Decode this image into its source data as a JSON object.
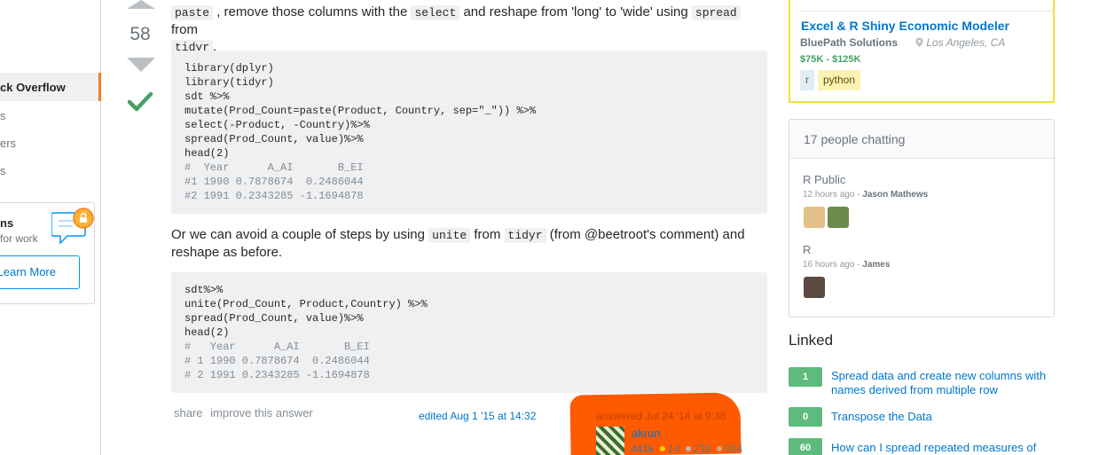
{
  "left_nav": {
    "stack_overflow": "ck Overflow",
    "item1": "s",
    "item2": "ers",
    "item3": "s",
    "teams_title": "ns",
    "teams_sub": "for work",
    "learn_more": "Learn More"
  },
  "vote": {
    "count": "58"
  },
  "answer": {
    "intro_pre": ", remove those columns with the",
    "intro_code1": "paste",
    "intro_code2": "select",
    "intro_mid": "and reshape from 'long' to 'wide' using",
    "intro_code3": "spread",
    "intro_from": "from",
    "intro_code4": "tidyr",
    "intro_end": ".",
    "code1": [
      "library(dplyr)",
      "library(tidyr)",
      "sdt %>%",
      "mutate(Prod_Count=paste(Product, Country, sep=\"_\")) %>%",
      "select(-Product, -Country)%>%",
      "spread(Prod_Count, value)%>%",
      "head(2)"
    ],
    "code1_comments": [
      "#  Year      A_AI       B_EI",
      "#1 1990 0.7878674  0.2486044",
      "#2 1991 0.2343285 -1.1694878"
    ],
    "para2_a": "Or we can avoid a couple of steps by using",
    "para2_code1": "unite",
    "para2_from": "from",
    "para2_code2": "tidyr",
    "para2_b": "(from @beetroot's comment) and",
    "para2_c": "reshape as before.",
    "code2": [
      "sdt%>%",
      "unite(Prod_Count, Product,Country) %>%",
      "spread(Prod_Count, value)%>%",
      "head(2)"
    ],
    "code2_comments": [
      "#   Year      A_AI       B_EI",
      "# 1 1990 0.7878674  0.2486044",
      "# 2 1991 0.2343285 -1.1694878"
    ],
    "share": "share",
    "improve": "improve this answer",
    "edited": "edited Aug 1 '15 at 14:32",
    "answered": "answered Jul 24 '14 at 9:38",
    "user": "akrun",
    "rep": "441k",
    "gold": "14",
    "silver": "238",
    "bronze": "324"
  },
  "job": {
    "title": "Excel & R Shiny Economic Modeler",
    "company": "BluePath Solutions",
    "location": "Los Angeles, CA",
    "salary": "$75K - $125K",
    "tags": [
      "r",
      "python"
    ]
  },
  "chat": {
    "title": "17 people chatting",
    "rooms": [
      {
        "name": "R Public",
        "time": "12 hours ago",
        "sep": " - ",
        "user": "Jason Mathews"
      },
      {
        "name": "R",
        "time": "16 hours ago",
        "sep": " - ",
        "user": "James"
      }
    ]
  },
  "linked": {
    "heading": "Linked",
    "items": [
      {
        "score": "1",
        "title": "Spread data and create new columns with names derived from multiple row"
      },
      {
        "score": "0",
        "title": "Transpose the Data"
      },
      {
        "score": "60",
        "title": "How can I spread repeated measures of"
      }
    ]
  },
  "colors": {
    "accent": "#f48024",
    "link": "#0077cc",
    "accepted": "#45a163",
    "redaction": "#ff5a00",
    "job_border": "#f1e035"
  }
}
